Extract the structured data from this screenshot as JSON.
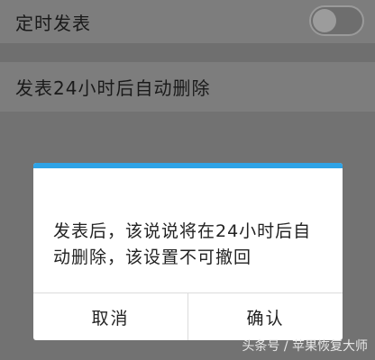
{
  "settings": {
    "scheduled_post_label": "定时发表",
    "scheduled_post_enabled": false,
    "auto_delete_label": "发表24小时后自动删除",
    "auto_delete_enabled": true,
    "toggle_on_color": "#1c6d2c"
  },
  "dialog": {
    "accent_color": "#2ea3e6",
    "message": "发表后，该说说将在24小时后自动删除，该设置不可撤回",
    "cancel_label": "取消",
    "confirm_label": "确认"
  },
  "watermark": {
    "text": "头条号 / 苹果恢复大师"
  }
}
